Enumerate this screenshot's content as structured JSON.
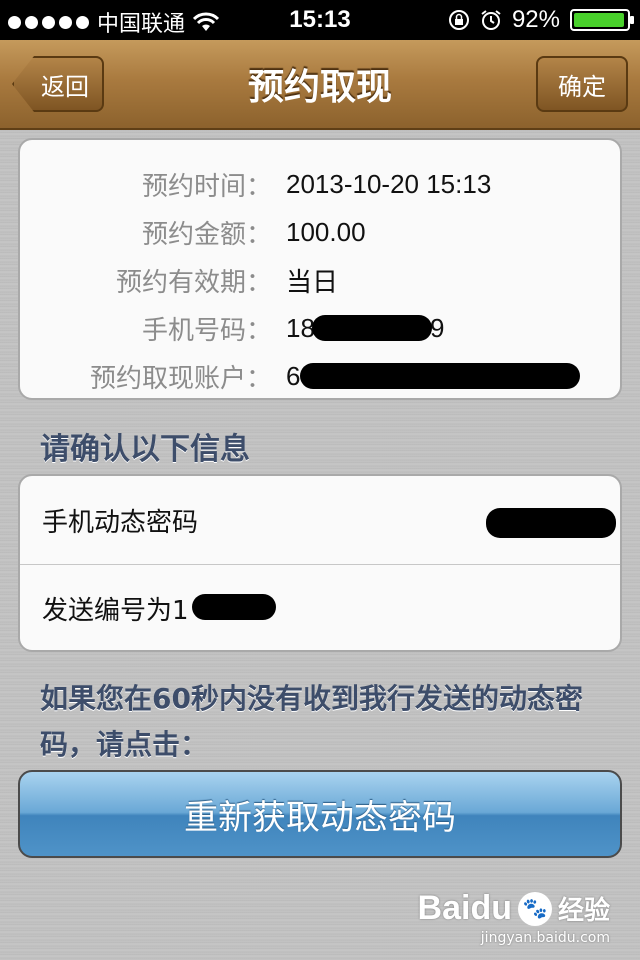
{
  "status_bar": {
    "carrier": "中国联通",
    "time": "15:13",
    "battery_percent": "92%",
    "battery_level": 0.92
  },
  "navbar": {
    "back_label": "返回",
    "title": "预约取现",
    "confirm_label": "确定"
  },
  "details": [
    {
      "label": "预约时间：",
      "value": "2013-10-20 15:13"
    },
    {
      "label": "预约金额：",
      "value": "100.00"
    },
    {
      "label": "预约有效期：",
      "value": "当日"
    },
    {
      "label": "手机号码：",
      "value": "18",
      "value_end": "9"
    },
    {
      "label": "预约取现账户：",
      "value": "6"
    }
  ],
  "section_title": "请确认以下信息",
  "confirm_rows": {
    "otp_label": "手机动态密码",
    "send_no_label": "发送编号为1"
  },
  "notice": "如果您在60秒内没有收到我行发送的动态密码，请点击：",
  "resend_button": "重新获取动态密码",
  "watermark": {
    "brand": "Baidu",
    "brand_cn": "经验",
    "url": "jingyan.baidu.com"
  }
}
